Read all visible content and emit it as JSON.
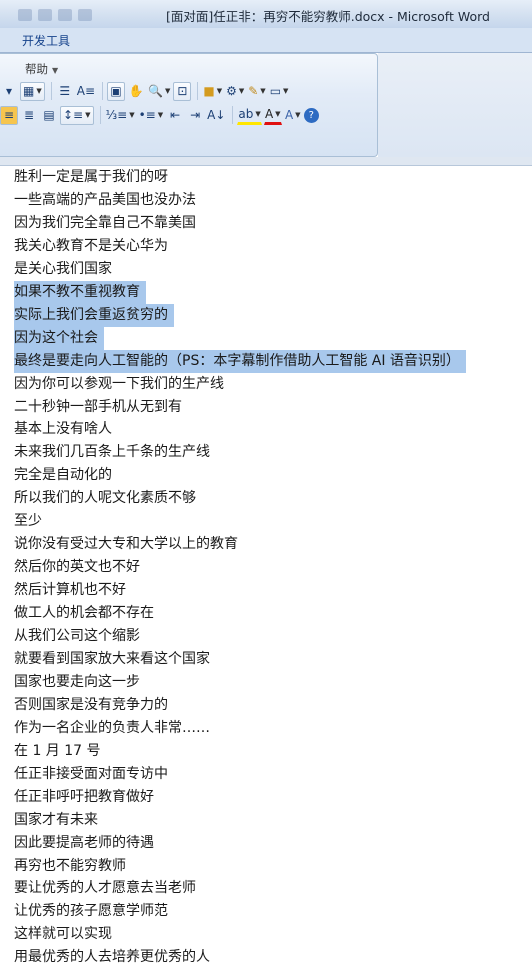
{
  "window": {
    "title": "[面对面]任正非：再穷不能穷教师.docx - Microsoft Word"
  },
  "ribbon": {
    "tab": "开发工具",
    "help": "帮助",
    "row1": [
      "table-icon",
      "para-icon",
      "text-direction-icon",
      "insert-picture-icon",
      "cursor-icon",
      "zoom-icon",
      "fit-icon",
      "folder-icon",
      "save-icon",
      "style-icon",
      "insert-box-icon"
    ],
    "row2": [
      "align-left-icon",
      "align-center-icon",
      "justify-icon",
      "line-spacing-icon",
      "numbering-icon",
      "bullets-icon",
      "decrease-indent-icon",
      "increase-indent-icon",
      "sort-icon",
      "highlight-icon",
      "font-color-icon",
      "char-style-icon",
      "help-icon"
    ]
  },
  "document": {
    "lines": [
      {
        "text": "胜利一定是属于我们的呀",
        "selected": false
      },
      {
        "text": "一些高端的产品美国也没办法",
        "selected": false
      },
      {
        "text": "因为我们完全靠自己不靠美国",
        "selected": false
      },
      {
        "text": "我关心教育不是关心华为",
        "selected": false
      },
      {
        "text": "是关心我们国家",
        "selected": false
      },
      {
        "text": "如果不教不重视教育",
        "selected": true
      },
      {
        "text": "实际上我们会重返贫穷的",
        "selected": true
      },
      {
        "text": "因为这个社会",
        "selected": true
      },
      {
        "text": "最终是要走向人工智能的（PS：本字幕制作借助人工智能 AI 语音识别）",
        "selected": true
      },
      {
        "text": "因为你可以参观一下我们的生产线",
        "selected": false
      },
      {
        "text": "二十秒钟一部手机从无到有",
        "selected": false
      },
      {
        "text": "基本上没有啥人",
        "selected": false
      },
      {
        "text": "未来我们几百条上千条的生产线",
        "selected": false
      },
      {
        "text": "完全是自动化的",
        "selected": false
      },
      {
        "text": "所以我们的人呢文化素质不够",
        "selected": false
      },
      {
        "text": "至少",
        "selected": false
      },
      {
        "text": "说你没有受过大专和大学以上的教育",
        "selected": false
      },
      {
        "text": "然后你的英文也不好",
        "selected": false
      },
      {
        "text": "然后计算机也不好",
        "selected": false
      },
      {
        "text": "做工人的机会都不存在",
        "selected": false
      },
      {
        "text": "从我们公司这个缩影",
        "selected": false
      },
      {
        "text": "就要看到国家放大来看这个国家",
        "selected": false
      },
      {
        "text": "国家也要走向这一步",
        "selected": false
      },
      {
        "text": "否则国家是没有竞争力的",
        "selected": false
      },
      {
        "text": "作为一名企业的负责人非常……",
        "selected": false
      },
      {
        "text": "在 1 月 17 号",
        "selected": false
      },
      {
        "text": "任正非接受面对面专访中",
        "selected": false
      },
      {
        "text": "任正非呼吁把教育做好",
        "selected": false
      },
      {
        "text": "国家才有未来",
        "selected": false
      },
      {
        "text": "因此要提高老师的待遇",
        "selected": false
      },
      {
        "text": "再穷也不能穷教师",
        "selected": false
      },
      {
        "text": "要让优秀的人才愿意去当老师",
        "selected": false
      },
      {
        "text": "让优秀的孩子愿意学师范",
        "selected": false
      },
      {
        "text": "这样就可以实现",
        "selected": false
      },
      {
        "text": "用最优秀的人去培养更优秀的人",
        "selected": false
      }
    ]
  }
}
